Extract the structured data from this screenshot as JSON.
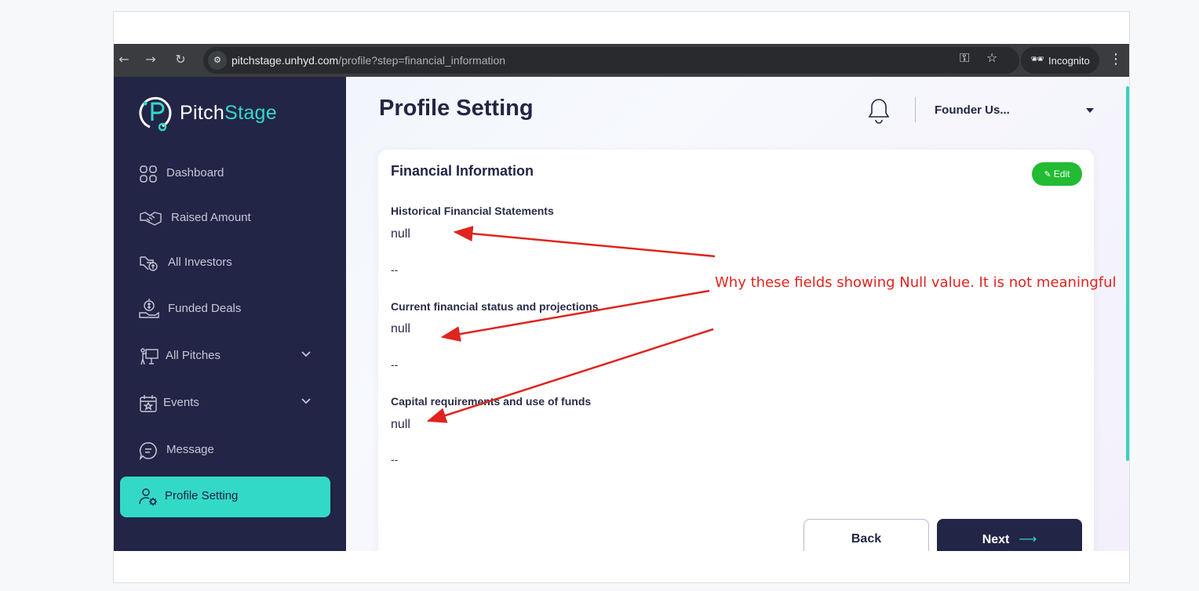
{
  "browser": {
    "url_host": "pitchstage.unhyd.com",
    "url_path": "/profile?step=financial_information",
    "incognito_label": "Incognito"
  },
  "brand": {
    "name_part1": "Pitch",
    "name_part2": "Stage",
    "accent_color": "#34d8c8"
  },
  "sidebar": {
    "items": [
      {
        "label": "Dashboard",
        "icon": "grid-icon"
      },
      {
        "label": "Raised Amount",
        "icon": "handshake-icon"
      },
      {
        "label": "All Investors",
        "icon": "investor-hand-icon"
      },
      {
        "label": "Funded Deals",
        "icon": "money-hand-icon"
      },
      {
        "label": "All Pitches",
        "icon": "presentation-icon"
      },
      {
        "label": "Events",
        "icon": "calendar-star-icon"
      },
      {
        "label": "Message",
        "icon": "chat-icon"
      },
      {
        "label": "Profile Setting",
        "icon": "user-gear-icon"
      }
    ]
  },
  "header": {
    "title": "Profile Setting",
    "user_name": "Founder Us..."
  },
  "card": {
    "title": "Financial Information",
    "edit_label": "Edit",
    "fields": [
      {
        "label": "Historical Financial Statements",
        "value": "null",
        "extra": "--"
      },
      {
        "label": "Current financial status and projections",
        "value": "null",
        "extra": "--"
      },
      {
        "label": "Capital requirements and use of funds",
        "value": "null",
        "extra": "--"
      }
    ]
  },
  "buttons": {
    "back": "Back",
    "next": "Next",
    "next_arrow": "⟶"
  },
  "annotation": {
    "text": "Why these fields showing Null value. It is not meaningful",
    "color": "#e0241e"
  },
  "colors": {
    "sidebar_bg": "#222546",
    "active_bg": "#33d9c7",
    "edit_green": "#22bb33"
  }
}
